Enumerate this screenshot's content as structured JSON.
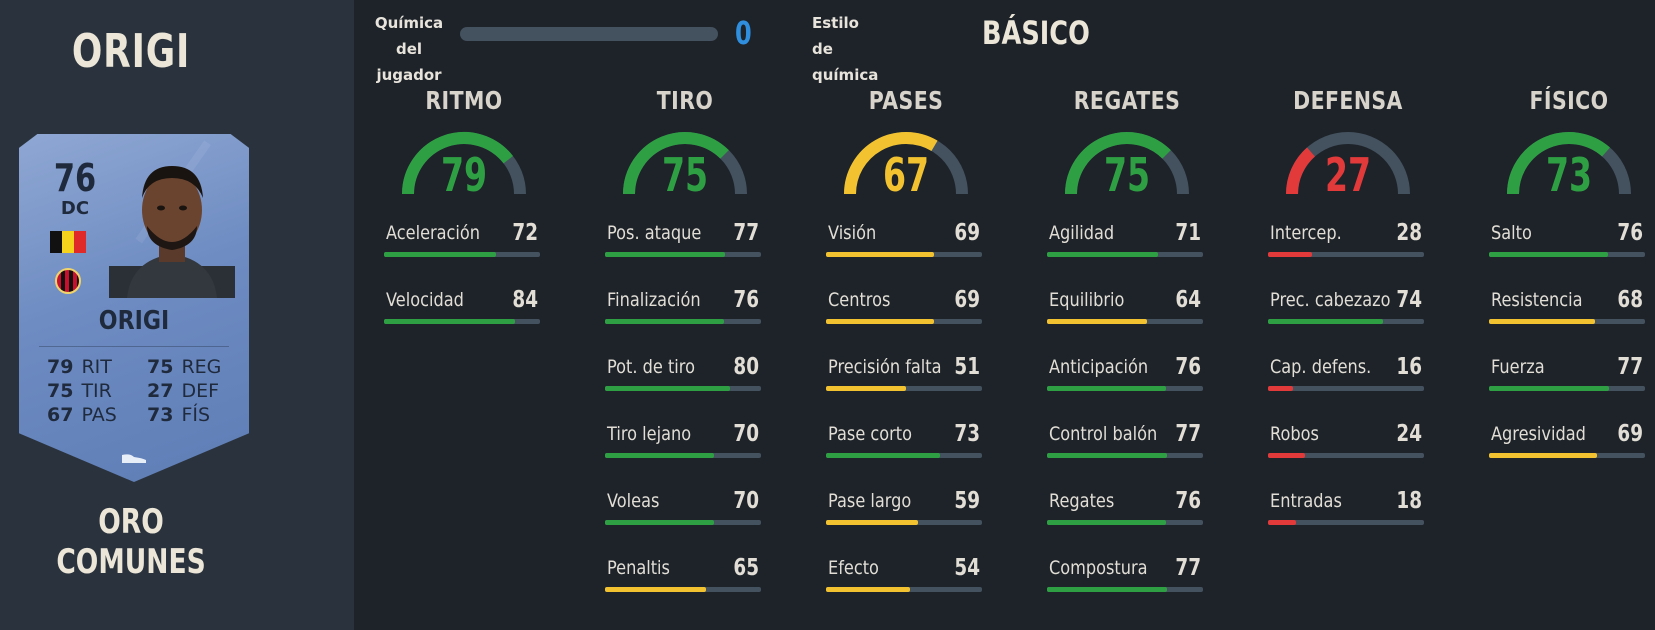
{
  "player": {
    "title": "ORIGI",
    "card_type": "ORO COMUNES"
  },
  "card": {
    "rating": "76",
    "position": "DC",
    "name": "ORIGI",
    "stats": [
      {
        "value": "79",
        "label": "RIT"
      },
      {
        "value": "75",
        "label": "REG"
      },
      {
        "value": "75",
        "label": "TIR"
      },
      {
        "value": "27",
        "label": "DEF"
      },
      {
        "value": "67",
        "label": "PAS"
      },
      {
        "value": "73",
        "label": "FÍS"
      }
    ],
    "flag_colors": [
      "#111111",
      "#f5d21c",
      "#e02a2a"
    ],
    "club_icon": "ac-milan-crest-icon",
    "boot_icon": "boot-icon"
  },
  "header": {
    "chem_label": "Química del jugador",
    "chem_value": "0",
    "chem_fill": 0,
    "style_label": "Estilo de química",
    "style_value": "BÁSICO"
  },
  "colors": {
    "green": "#2ea043",
    "yellow": "#f2c230",
    "red": "#e23a3a",
    "track": "#44515e"
  },
  "columns": [
    {
      "title": "RITMO",
      "value": 79,
      "attributes": [
        {
          "name": "Aceleración",
          "value": 72
        },
        {
          "name": "Velocidad",
          "value": 84
        }
      ]
    },
    {
      "title": "TIRO",
      "value": 75,
      "attributes": [
        {
          "name": "Pos. ataque",
          "value": 77
        },
        {
          "name": "Finalización",
          "value": 76
        },
        {
          "name": "Pot. de tiro",
          "value": 80
        },
        {
          "name": "Tiro lejano",
          "value": 70
        },
        {
          "name": "Voleas",
          "value": 70
        },
        {
          "name": "Penaltis",
          "value": 65
        }
      ]
    },
    {
      "title": "PASES",
      "value": 67,
      "attributes": [
        {
          "name": "Visión",
          "value": 69
        },
        {
          "name": "Centros",
          "value": 69
        },
        {
          "name": "Precisión falta",
          "value": 51
        },
        {
          "name": "Pase corto",
          "value": 73
        },
        {
          "name": "Pase largo",
          "value": 59
        },
        {
          "name": "Efecto",
          "value": 54
        }
      ]
    },
    {
      "title": "REGATES",
      "value": 75,
      "attributes": [
        {
          "name": "Agilidad",
          "value": 71
        },
        {
          "name": "Equilibrio",
          "value": 64
        },
        {
          "name": "Anticipación",
          "value": 76
        },
        {
          "name": "Control balón",
          "value": 77
        },
        {
          "name": "Regates",
          "value": 76
        },
        {
          "name": "Compostura",
          "value": 77
        }
      ]
    },
    {
      "title": "DEFENSA",
      "value": 27,
      "attributes": [
        {
          "name": "Intercep.",
          "value": 28
        },
        {
          "name": "Prec. cabezazo",
          "value": 74
        },
        {
          "name": "Cap. defens.",
          "value": 16
        },
        {
          "name": "Robos",
          "value": 24
        },
        {
          "name": "Entradas",
          "value": 18
        }
      ]
    },
    {
      "title": "FÍSICO",
      "value": 73,
      "attributes": [
        {
          "name": "Salto",
          "value": 76
        },
        {
          "name": "Resistencia",
          "value": 68
        },
        {
          "name": "Fuerza",
          "value": 77
        },
        {
          "name": "Agresividad",
          "value": 69
        }
      ]
    }
  ]
}
